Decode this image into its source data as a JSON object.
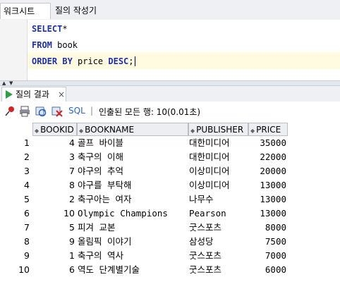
{
  "tabs": [
    {
      "label": "워크시트"
    },
    {
      "label": "질의 작성기"
    }
  ],
  "editor": {
    "lines": [
      {
        "keyword": "SELECT",
        "rest": "*"
      },
      {
        "keyword": "FROM",
        "rest": " book"
      },
      {
        "keyword": "ORDER BY",
        "rest": " price ",
        "keyword2": "DESC",
        "rest2": ";"
      }
    ]
  },
  "results_tab": {
    "label": "질의 결과",
    "close": "×"
  },
  "toolbar": {
    "icons": [
      "pin-icon",
      "print-icon",
      "refresh-icon",
      "delete-icon"
    ],
    "sql_label": "SQL",
    "separator": "|",
    "status": "인출된 모든 행: 10(0.01초)"
  },
  "grid": {
    "columns": [
      "BOOKID",
      "BOOKNAME",
      "PUBLISHER",
      "PRICE"
    ],
    "rows": [
      {
        "n": "1",
        "bookid": "4",
        "bookname": "골프 바이블",
        "publisher": "대한미디어",
        "price": "35000"
      },
      {
        "n": "2",
        "bookid": "3",
        "bookname": "축구의 이해",
        "publisher": "대한미디어",
        "price": "22000"
      },
      {
        "n": "3",
        "bookid": "7",
        "bookname": "야구의 추억",
        "publisher": "이상미디어",
        "price": "20000"
      },
      {
        "n": "4",
        "bookid": "8",
        "bookname": "야구를 부탁해",
        "publisher": "이상미디어",
        "price": "13000"
      },
      {
        "n": "5",
        "bookid": "2",
        "bookname": "축구아는 여자",
        "publisher": "나무수",
        "price": "13000"
      },
      {
        "n": "6",
        "bookid": "10",
        "bookname": "Olympic Champions",
        "publisher": "Pearson",
        "price": "13000"
      },
      {
        "n": "7",
        "bookid": "5",
        "bookname": "피겨 교본",
        "publisher": "굿스포츠",
        "price": "8000"
      },
      {
        "n": "8",
        "bookid": "9",
        "bookname": "올림픽 이야기",
        "publisher": "삼성당",
        "price": "7500"
      },
      {
        "n": "9",
        "bookid": "1",
        "bookname": "축구의 역사",
        "publisher": "굿스포츠",
        "price": "7000"
      },
      {
        "n": "10",
        "bookid": "6",
        "bookname": "역도 단계별기술",
        "publisher": "굿스포츠",
        "price": "6000"
      }
    ]
  },
  "colors": {
    "keyword": "#1b2fb3",
    "accent": "#2a64c8"
  }
}
